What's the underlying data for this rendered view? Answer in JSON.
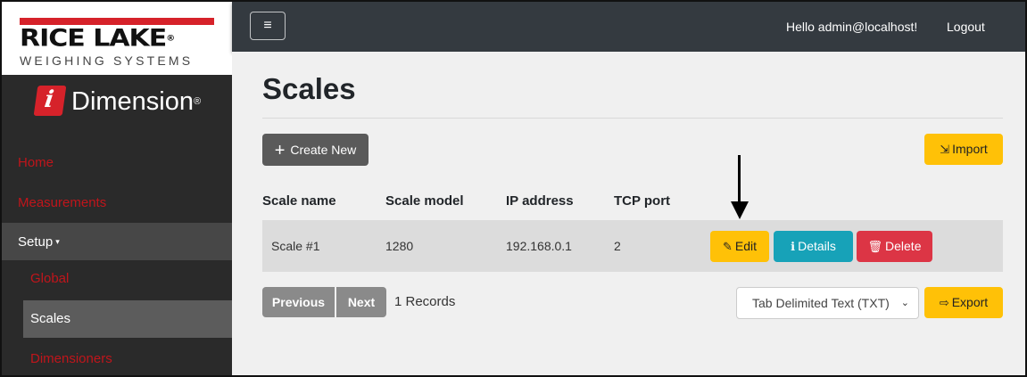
{
  "brand": {
    "name": "RICE LAKE",
    "registered": "®",
    "subtitle": "WEIGHING SYSTEMS",
    "product_letter": "i",
    "product": "Dimension",
    "product_registered": "®",
    "red": "#d6222a"
  },
  "sidebar": {
    "items": [
      {
        "label": "Home"
      },
      {
        "label": "Measurements"
      },
      {
        "label": "Setup",
        "caret": "▾"
      },
      {
        "label": "Global"
      },
      {
        "label": "Scales"
      },
      {
        "label": "Dimensioners"
      }
    ]
  },
  "header": {
    "menu_icon": "≡",
    "greeting": "Hello admin@localhost!",
    "logout": "Logout"
  },
  "page": {
    "title": "Scales",
    "create_label": "Create New",
    "create_icon": "+",
    "import_label": "Import",
    "import_icon": "⇲"
  },
  "table": {
    "columns": [
      "Scale name",
      "Scale model",
      "IP address",
      "TCP port"
    ],
    "rows": [
      {
        "name": "Scale #1",
        "model": "1280",
        "ip": "192.168.0.1",
        "port": "2"
      }
    ],
    "actions": {
      "edit": "Edit",
      "details": "Details",
      "delete": "Delete",
      "edit_icon": "✎",
      "details_icon": "ℹ",
      "delete_icon": "🗑"
    }
  },
  "pager": {
    "previous": "Previous",
    "next": "Next",
    "records": "1 Records"
  },
  "export": {
    "format": "Tab Delimited Text (TXT)",
    "label": "Export",
    "icon": "⇨"
  },
  "colors": {
    "warning": "#ffc107",
    "info": "#17a2b8",
    "danger": "#dc3545",
    "nav_red": "#c0151b",
    "topbar": "#343a40"
  }
}
